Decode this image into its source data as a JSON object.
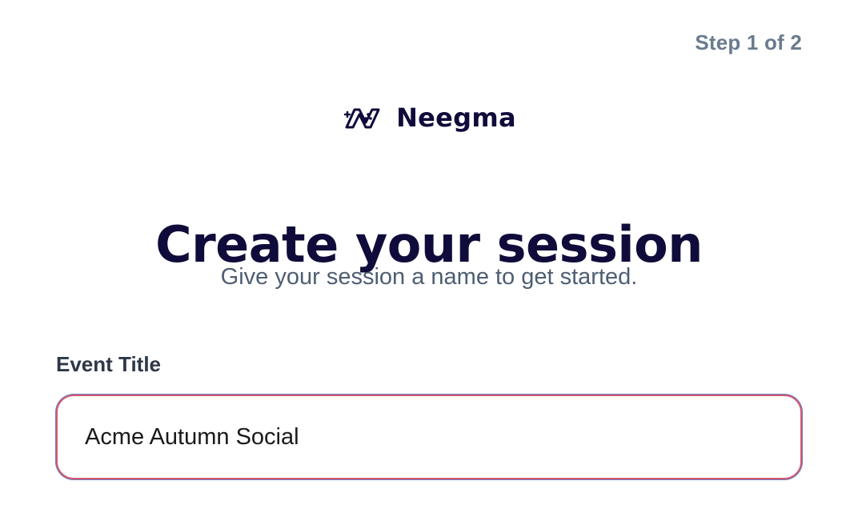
{
  "header": {
    "step_text": "Step 1 of 2"
  },
  "brand": {
    "logo_icon": "neegma-logo-icon",
    "name": "Neegma",
    "color": "#0f0b3a"
  },
  "main": {
    "title": "Create your session",
    "subtitle": "Give your session a name to get started."
  },
  "form": {
    "event_title": {
      "label": "Event Title",
      "value": "Acme Autumn Social",
      "border_color": "#d45a6e"
    }
  }
}
